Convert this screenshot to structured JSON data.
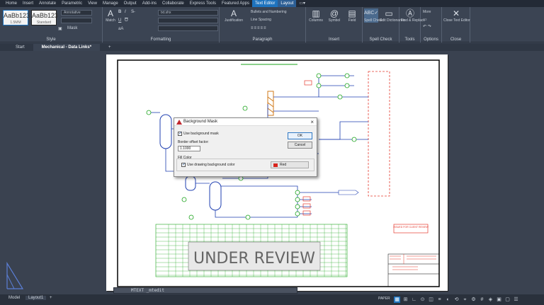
{
  "menu": {
    "tabs": [
      "Home",
      "Insert",
      "Annotate",
      "Parametric",
      "View",
      "Manage",
      "Output",
      "Add-ins",
      "Collaborate",
      "Express Tools",
      "Featured Apps",
      "Text Editor",
      "Layout"
    ],
    "context_tab": "Text Editor"
  },
  "ribbon": {
    "style": {
      "title": "Style",
      "box1": "AaBb123",
      "box1_sub": "1.5MM",
      "box2": "AaBb123",
      "box2_sub": "Standard",
      "annotative": "Annotative",
      "height_value": "",
      "mask_label": "Mask"
    },
    "formatting": {
      "title": "Formatting",
      "font": "txt.shx"
    },
    "paragraph": {
      "title": "Paragraph",
      "justification": "Justification",
      "bullets": "Bullets and Numbering",
      "line_spacing": "Line Spacing"
    },
    "insert": {
      "title": "Insert",
      "columns": "Columns",
      "symbol": "Symbol",
      "field": "Field"
    },
    "spell": {
      "title": "Spell Check",
      "spell_check": "Spell Check",
      "edit_dictionaries": "Edit Dictionaries"
    },
    "tools": {
      "title": "Tools",
      "find_replace": "Find & Replace"
    },
    "options": {
      "title": "Options",
      "more": "More"
    },
    "close": {
      "title": "Close",
      "close_editor": "Close Text Editor"
    }
  },
  "doc_tabs": [
    {
      "label": "Start",
      "active": false
    },
    {
      "label": "Mechanical - Data Links*",
      "active": true
    }
  ],
  "drawing": {
    "stamp_text": "UNDER REVIEW",
    "review_stamp": "ISSUED FOR CLIENT REVIEW"
  },
  "dialog": {
    "title": "Background Mask",
    "use_mask": "Use background mask",
    "use_mask_checked": true,
    "offset_label": "Border offset factor:",
    "offset_value": "1.1000",
    "fill_color_label": "Fill Color",
    "use_drawing_bg": "Use drawing background color",
    "use_drawing_bg_checked": true,
    "color_value": "Red",
    "color_hex": "#d8231c",
    "ok": "OK",
    "cancel": "Cancel"
  },
  "command_line": {
    "text": "MTEXT _mtedit"
  },
  "status": {
    "model": "Model",
    "layout": "Layout1",
    "paper": "PAPER"
  },
  "colors": {
    "accent": "#1e73be",
    "line_blue": "#1f3fb0",
    "line_green": "#1aa31a",
    "line_red": "#e53b2f"
  }
}
